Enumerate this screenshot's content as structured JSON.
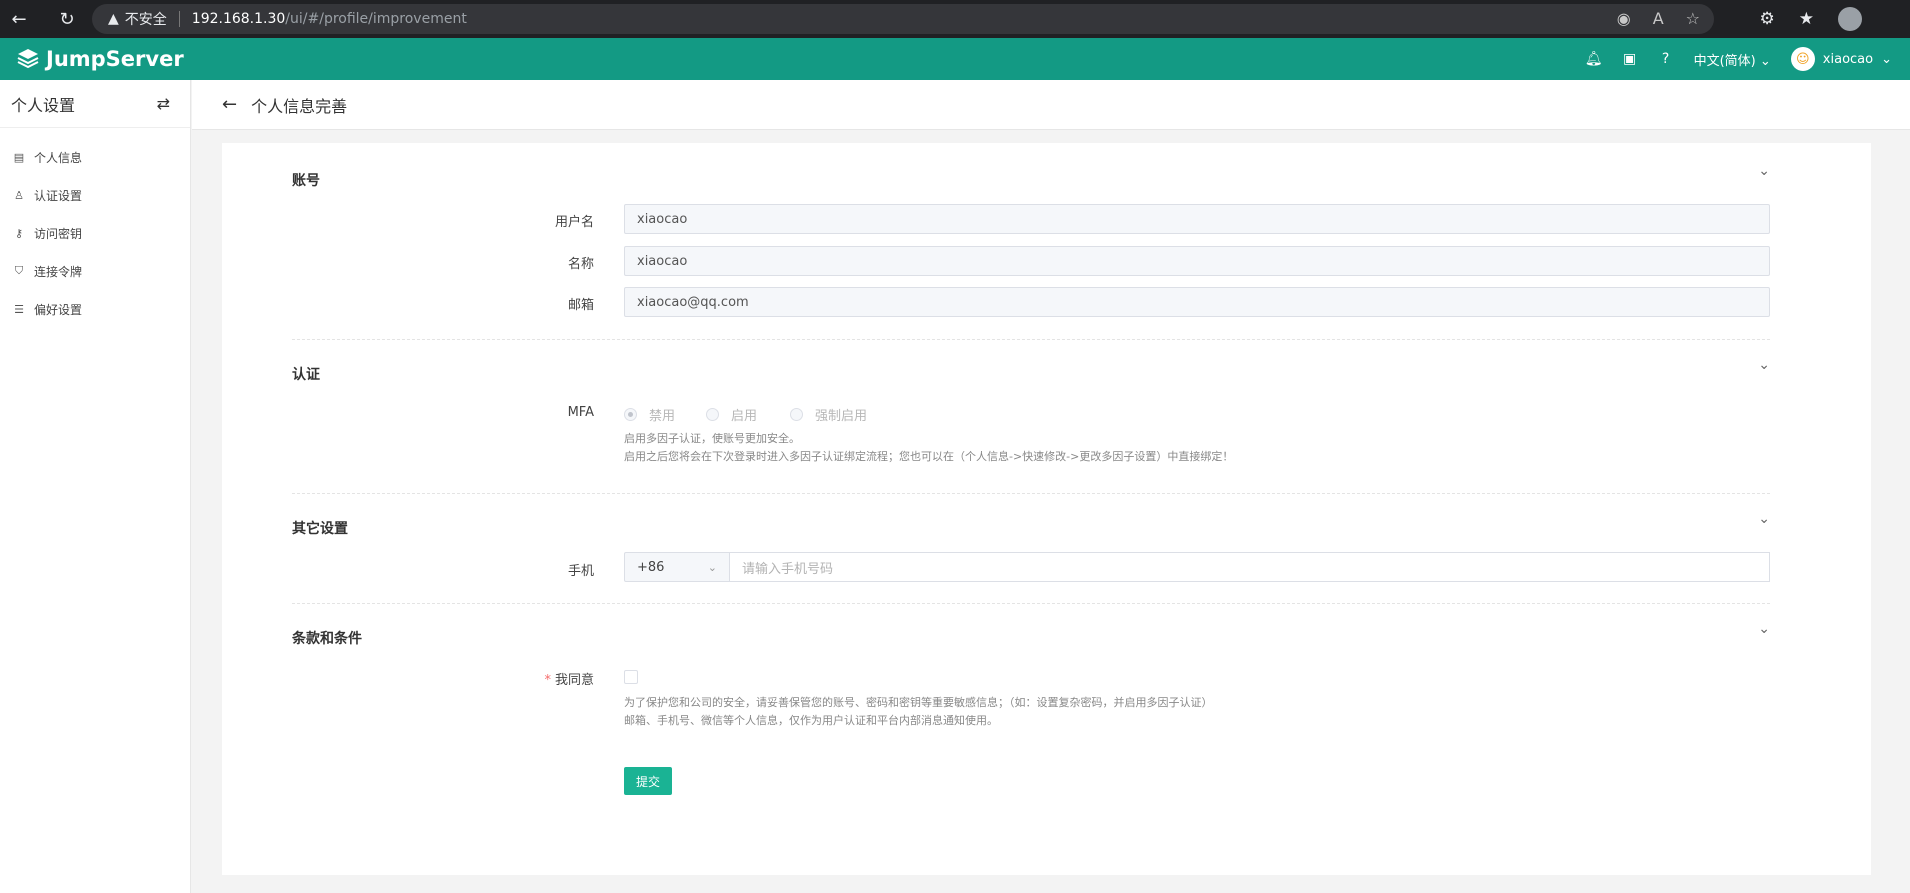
{
  "browser": {
    "security_label": "不安全",
    "url_host": "192.168.1.30",
    "url_path": "/ui/#/profile/improvement"
  },
  "app": {
    "brand": "JumpServer",
    "language": "中文(简体)",
    "username": "xiaocao",
    "accent_color": "#1ab394"
  },
  "sidebar": {
    "title": "个人设置",
    "items": [
      {
        "label": "个人信息",
        "icon": "id-card-icon"
      },
      {
        "label": "认证设置",
        "icon": "user-lock-icon"
      },
      {
        "label": "访问密钥",
        "icon": "key-icon"
      },
      {
        "label": "连接令牌",
        "icon": "shield-icon"
      },
      {
        "label": "偏好设置",
        "icon": "sliders-icon"
      }
    ]
  },
  "page": {
    "title": "个人信息完善"
  },
  "account": {
    "section_title": "账号",
    "username_label": "用户名",
    "username_value": "xiaocao",
    "name_label": "名称",
    "name_value": "xiaocao",
    "email_label": "邮箱",
    "email_value": "xiaocao@qq.com"
  },
  "auth": {
    "section_title": "认证",
    "mfa_label": "MFA",
    "options": [
      "禁用",
      "启用",
      "强制启用"
    ],
    "selected": "禁用",
    "help_line1": "启用多因子认证，使账号更加安全。",
    "help_line2": "启用之后您将会在下次登录时进入多因子认证绑定流程；您也可以在（个人信息->快速修改->更改多因子设置）中直接绑定！"
  },
  "other": {
    "section_title": "其它设置",
    "phone_label": "手机",
    "phone_code": "+86",
    "phone_placeholder": "请输入手机号码"
  },
  "terms": {
    "section_title": "条款和条件",
    "agree_label": "我同意",
    "required_mark": "*",
    "help_line1": "为了保护您和公司的安全，请妥善保管您的账号、密码和密钥等重要敏感信息；（如：设置复杂密码，并启用多因子认证）",
    "help_line2": "邮箱、手机号、微信等个人信息，仅作为用户认证和平台内部消息通知使用。"
  },
  "submit_label": "提交"
}
